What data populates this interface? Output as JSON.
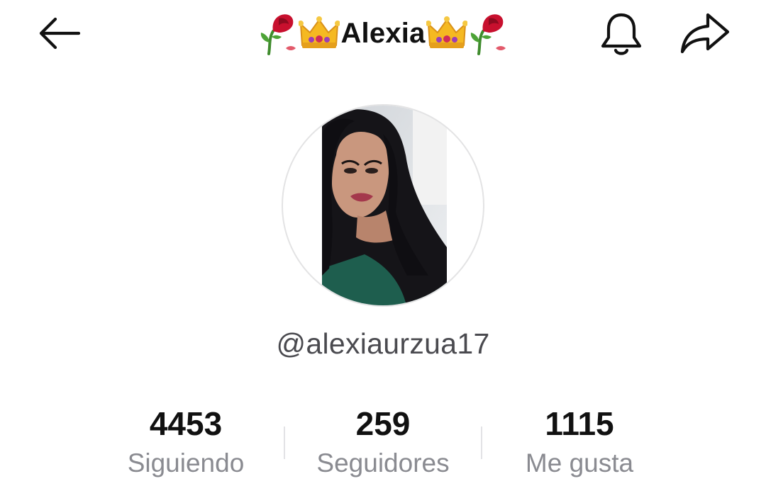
{
  "header": {
    "title": "Alexia",
    "decorations": [
      "rose-icon",
      "crown-icon",
      "crown-icon",
      "rose-icon"
    ],
    "back_icon": "arrow-left-icon",
    "bell_icon": "bell-icon",
    "share_icon": "share-arrow-icon"
  },
  "profile": {
    "username": "@alexiaurzua17"
  },
  "stats": {
    "following": {
      "value": "4453",
      "label": "Siguiendo"
    },
    "followers": {
      "value": "259",
      "label": "Seguidores"
    },
    "likes": {
      "value": "1115",
      "label": "Me gusta"
    }
  },
  "colors": {
    "background": "#ffffff",
    "primary_text": "#111111",
    "secondary_text": "#8a8b91",
    "username_text": "#4a4a4f",
    "divider": "#e3e3e6"
  }
}
